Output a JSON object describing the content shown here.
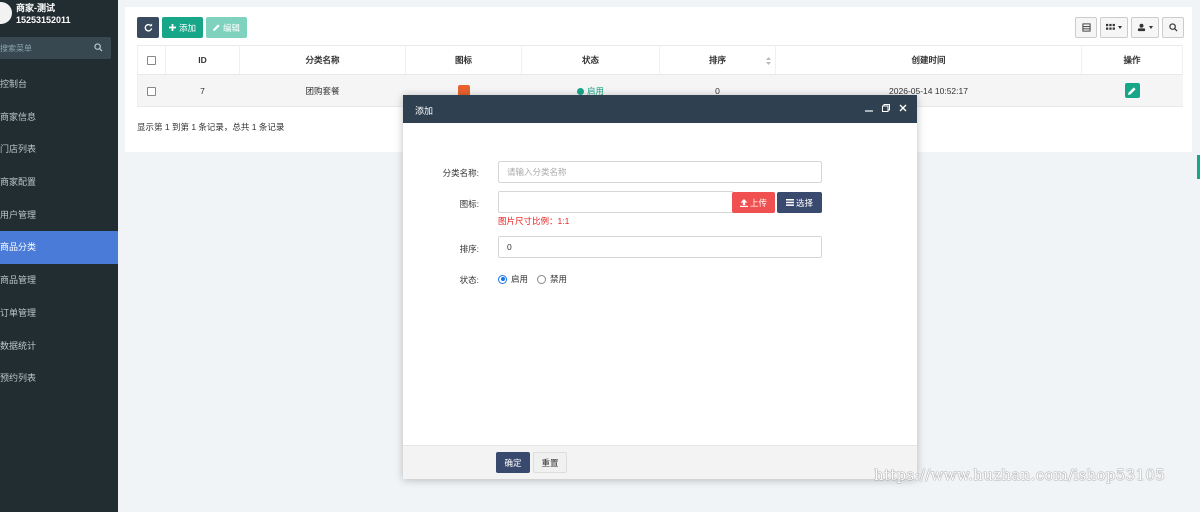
{
  "sidebar": {
    "user_name": "商家-测试",
    "user_phone": "15253152011",
    "search_placeholder": "搜索菜单",
    "items": [
      {
        "label": "控制台",
        "active": false
      },
      {
        "label": "商家信息",
        "active": false
      },
      {
        "label": "门店列表",
        "active": false
      },
      {
        "label": "商家配置",
        "active": false
      },
      {
        "label": "用户管理",
        "active": false
      },
      {
        "label": "商品分类",
        "active": true
      },
      {
        "label": "商品管理",
        "active": false
      },
      {
        "label": "订单管理",
        "active": false
      },
      {
        "label": "数据统计",
        "active": false
      },
      {
        "label": "预约列表",
        "active": false
      }
    ]
  },
  "toolbar": {
    "refresh_icon": "refresh-icon",
    "add_label": "添加",
    "edit_label": "编辑"
  },
  "table": {
    "headers": {
      "id": "ID",
      "name": "分类名称",
      "icon": "图标",
      "status": "状态",
      "sort": "排序",
      "created": "创建时间",
      "op": "操作"
    },
    "rows": [
      {
        "id": "7",
        "name": "团购套餐",
        "status": "启用",
        "sort": "0",
        "created": "2026-05-14 10:52:17"
      }
    ],
    "footer": "显示第 1 到第 1 条记录，总共 1 条记录"
  },
  "modal": {
    "title": "添加",
    "name_label": "分类名称:",
    "name_placeholder": "请输入分类名称",
    "icon_label": "图标:",
    "icon_value": "",
    "upload_label": "上传",
    "choose_label": "选择",
    "hint": "图片尺寸比例：1:1",
    "sort_label": "排序:",
    "sort_value": "0",
    "status_label": "状态:",
    "status_options": [
      "启用",
      "禁用"
    ],
    "status_selected": "启用",
    "ok_label": "确定",
    "reset_label": "重置"
  },
  "watermark": "https://www.huzhan.com/ishop53105",
  "colors": {
    "sidebar_bg": "#222d32",
    "sidebar_active": "#4a7bd8",
    "primary_green": "#18a689",
    "modal_header": "#2f4050",
    "upload_red": "#f05050",
    "choose_dark": "#3a4a6e",
    "hint_red": "#e81e1e"
  }
}
